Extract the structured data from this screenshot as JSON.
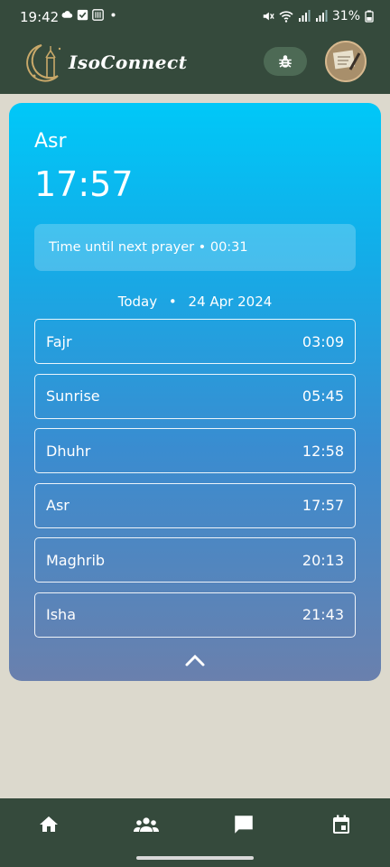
{
  "status_bar": {
    "time": "19:42",
    "battery": "31%"
  },
  "header": {
    "app_name": "IsoConnect"
  },
  "current_prayer": {
    "name": "Asr",
    "time": "17:57"
  },
  "countdown": {
    "text": "Time until next prayer • 00:31"
  },
  "date_row": {
    "day": "Today",
    "separator": "•",
    "date": "24 Apr 2024"
  },
  "prayers": [
    {
      "name": "Fajr",
      "time": "03:09"
    },
    {
      "name": "Sunrise",
      "time": "05:45"
    },
    {
      "name": "Dhuhr",
      "time": "12:58"
    },
    {
      "name": "Asr",
      "time": "17:57"
    },
    {
      "name": "Maghrib",
      "time": "20:13"
    },
    {
      "name": "Isha",
      "time": "21:43"
    }
  ],
  "nav": {
    "items": [
      {
        "icon": "home-icon"
      },
      {
        "icon": "people-icon"
      },
      {
        "icon": "chat-icon"
      },
      {
        "icon": "calendar-icon"
      }
    ]
  },
  "colors": {
    "header_bg": "#354a3c",
    "card_top": "#00c8f8",
    "card_bottom": "#6a80ad",
    "page_bg": "#dcd9cd"
  }
}
